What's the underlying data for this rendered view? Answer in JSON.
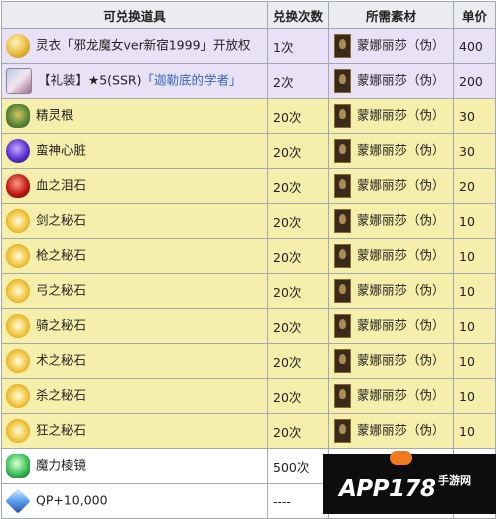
{
  "headers": {
    "item": "可兑换道具",
    "count": "兑换次数",
    "material": "所需素材",
    "price": "单价"
  },
  "rows": [
    {
      "item": "灵衣「邪龙魔女ver新宿1999」开放权",
      "count": "1次",
      "material": "蒙娜丽莎（伪）",
      "price": "400",
      "bg": "purple",
      "icon": "gold-coin-icon"
    },
    {
      "item_pre": "【礼装】★5(SSR)",
      "item_link": "「迦勒底的学者」",
      "count": "2次",
      "material": "蒙娜丽莎（伪）",
      "price": "200",
      "bg": "purple",
      "icon": "craft-essence-portrait-icon"
    },
    {
      "item": "精灵根",
      "count": "20次",
      "material": "蒙娜丽莎（伪）",
      "price": "30",
      "bg": "yellow",
      "icon": "fairy-root-icon"
    },
    {
      "item": "蛮神心脏",
      "count": "20次",
      "material": "蒙娜丽莎（伪）",
      "price": "30",
      "bg": "yellow",
      "icon": "heart-of-foreign-god-icon"
    },
    {
      "item": "血之泪石",
      "count": "20次",
      "material": "蒙娜丽莎（伪）",
      "price": "20",
      "bg": "yellow",
      "icon": "bloodstone-tear-icon"
    },
    {
      "item": "剑之秘石",
      "count": "20次",
      "material": "蒙娜丽莎（伪）",
      "price": "10",
      "bg": "yellow",
      "icon": "saber-gem-icon"
    },
    {
      "item": "枪之秘石",
      "count": "20次",
      "material": "蒙娜丽莎（伪）",
      "price": "10",
      "bg": "yellow",
      "icon": "lancer-gem-icon"
    },
    {
      "item": "弓之秘石",
      "count": "20次",
      "material": "蒙娜丽莎（伪）",
      "price": "10",
      "bg": "yellow",
      "icon": "archer-gem-icon"
    },
    {
      "item": "骑之秘石",
      "count": "20次",
      "material": "蒙娜丽莎（伪）",
      "price": "10",
      "bg": "yellow",
      "icon": "rider-gem-icon"
    },
    {
      "item": "术之秘石",
      "count": "20次",
      "material": "蒙娜丽莎（伪）",
      "price": "10",
      "bg": "yellow",
      "icon": "caster-gem-icon"
    },
    {
      "item": "杀之秘石",
      "count": "20次",
      "material": "蒙娜丽莎（伪）",
      "price": "10",
      "bg": "yellow",
      "icon": "assassin-gem-icon"
    },
    {
      "item": "狂之秘石",
      "count": "20次",
      "material": "蒙娜丽莎（伪）",
      "price": "10",
      "bg": "yellow",
      "icon": "berserker-gem-icon"
    },
    {
      "item": "魔力棱镜",
      "count": "500次",
      "material": "",
      "price": "",
      "bg": "white",
      "icon": "mana-prism-icon"
    },
    {
      "item": "QP+10,000",
      "count": "----",
      "material": "",
      "price": "",
      "bg": "white",
      "icon": "qp-icon"
    }
  ],
  "watermark": {
    "brand": "APP178",
    "sub": "手游网"
  },
  "colors": {
    "header": "#eaecf0",
    "purple": "#e9e1f6",
    "yellow": "#f6eeab",
    "link": "#3366cc",
    "border": "#a2a9b1"
  }
}
